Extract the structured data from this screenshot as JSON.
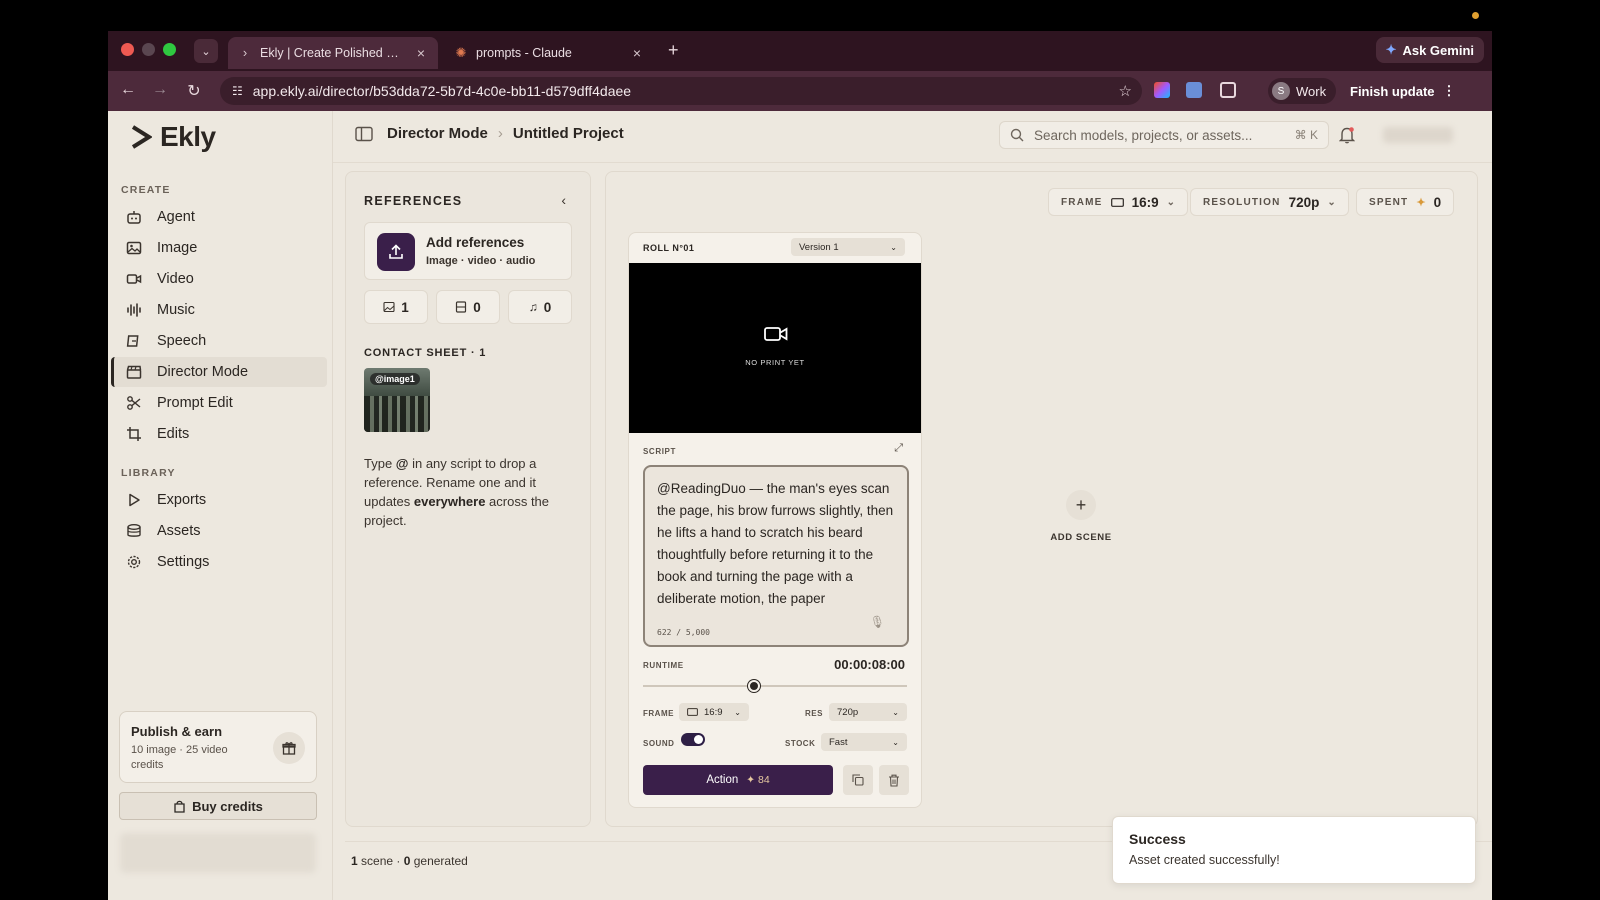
{
  "browser": {
    "tabs": [
      {
        "title": "Ekly | Create Polished Content",
        "favicon": "ekly-favicon",
        "active": true
      },
      {
        "title": "prompts - Claude",
        "favicon": "claude-favicon",
        "active": false
      }
    ],
    "ask_gemini": "Ask Gemini",
    "url": "app.ekly.ai/director/b53dda72-5b7d-4c0e-bb11-d579dff4daee",
    "profile_initial": "S",
    "profile_label": "Work",
    "finish_update": "Finish update"
  },
  "sidebar": {
    "logo": "Ekly",
    "create_label": "CREATE",
    "create_items": [
      {
        "label": "Agent",
        "icon": "robot-icon"
      },
      {
        "label": "Image",
        "icon": "image-icon"
      },
      {
        "label": "Video",
        "icon": "video-icon"
      },
      {
        "label": "Music",
        "icon": "waveform-icon"
      },
      {
        "label": "Speech",
        "icon": "speech-icon"
      },
      {
        "label": "Director Mode",
        "icon": "clapperboard-icon",
        "active": true
      },
      {
        "label": "Prompt Edit",
        "icon": "scissors-icon"
      },
      {
        "label": "Edits",
        "icon": "crop-icon"
      }
    ],
    "library_label": "LIBRARY",
    "library_items": [
      {
        "label": "Exports",
        "icon": "play-icon"
      },
      {
        "label": "Assets",
        "icon": "stack-icon"
      },
      {
        "label": "Settings",
        "icon": "gear-icon"
      }
    ],
    "publish": {
      "title": "Publish & earn",
      "subtitle": "10 image · 25 video credits"
    },
    "buy_credits": "Buy credits"
  },
  "header": {
    "breadcrumb_parent": "Director Mode",
    "breadcrumb_current": "Untitled Project",
    "search_placeholder": "Search models, projects, or assets...",
    "search_shortcut": "⌘ K"
  },
  "references": {
    "title": "REFERENCES",
    "add_title": "Add references",
    "add_subtitle": "Image · video · audio",
    "counts": {
      "image": "1",
      "video": "0",
      "audio": "0"
    },
    "contact_sheet_label": "CONTACT SHEET · 1",
    "thumb_tag": "@image1",
    "help_pre": "Type ",
    "help_at": "@",
    "help_mid": " in any script to drop a reference. Rename one and it updates ",
    "help_bold": "everywhere",
    "help_post": " across the project."
  },
  "toolbar": {
    "frame_label": "FRAME",
    "frame_value": "16:9",
    "resolution_label": "RESOLUTION",
    "resolution_value": "720p",
    "spent_label": "SPENT",
    "spent_value": "0"
  },
  "scene": {
    "roll": "ROLL N°01",
    "version": "Version 1",
    "no_print": "NO PRINT YET",
    "script_label": "SCRIPT",
    "script_text": "@ReadingDuo — the man's eyes scan the page, his brow furrows slightly, then he lifts a hand to scratch his beard thoughtfully before returning it to the book and turning the page with a deliberate motion, the paper",
    "char_count": "622 / 5,000",
    "runtime_label": "RUNTIME",
    "runtime_value": "00:00:08:00",
    "runtime_fraction": 0.42,
    "frame_label": "FRAME",
    "frame_value": "16:9",
    "res_label": "RES",
    "res_value": "720p",
    "sound_label": "SOUND",
    "sound_on": true,
    "stock_label": "STOCK",
    "stock_value": "Fast",
    "action_label": "Action",
    "action_cost": "✦ 84"
  },
  "add_scene": "ADD SCENE",
  "footer": {
    "scenes": "1",
    "scenes_text": " scene · ",
    "generated": "0",
    "generated_text": " generated"
  },
  "toast": {
    "title": "Success",
    "message": "Asset created successfully!"
  }
}
